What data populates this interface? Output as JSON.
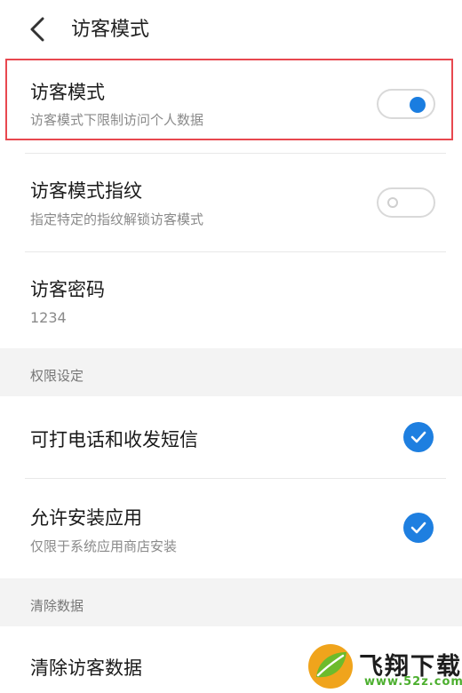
{
  "header": {
    "title": "访客模式",
    "back_icon": "chevron-left-icon"
  },
  "guest_mode": {
    "title": "访客模式",
    "subtitle": "访客模式下限制访问个人数据",
    "enabled": true,
    "accent_color": "#1a7de0",
    "highlight_color": "#e8484f"
  },
  "guest_fingerprint": {
    "title": "访客模式指纹",
    "subtitle": "指定特定的指纹解锁访客模式",
    "enabled": false
  },
  "guest_password": {
    "title": "访客密码",
    "value": "1234"
  },
  "permissions": {
    "section_label": "权限设定",
    "items": [
      {
        "title": "可打电话和收发短信",
        "subtitle": "",
        "checked": true
      },
      {
        "title": "允许安装应用",
        "subtitle": "仅限于系统应用商店安装",
        "checked": true
      }
    ]
  },
  "clear_data": {
    "section_label": "清除数据",
    "title": "清除访客数据"
  },
  "watermark": {
    "brand": "飞翔下载",
    "url": "www.52z.com"
  }
}
